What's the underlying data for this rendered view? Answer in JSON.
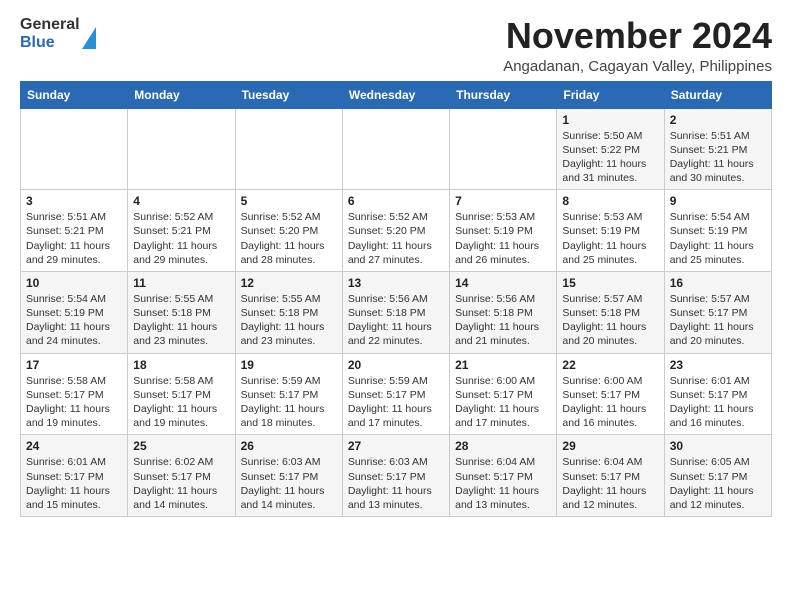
{
  "header": {
    "logo_general": "General",
    "logo_blue": "Blue",
    "month": "November 2024",
    "location": "Angadanan, Cagayan Valley, Philippines"
  },
  "days_of_week": [
    "Sunday",
    "Monday",
    "Tuesday",
    "Wednesday",
    "Thursday",
    "Friday",
    "Saturday"
  ],
  "weeks": [
    [
      {
        "day": "",
        "info": ""
      },
      {
        "day": "",
        "info": ""
      },
      {
        "day": "",
        "info": ""
      },
      {
        "day": "",
        "info": ""
      },
      {
        "day": "",
        "info": ""
      },
      {
        "day": "1",
        "info": "Sunrise: 5:50 AM\nSunset: 5:22 PM\nDaylight: 11 hours and 31 minutes."
      },
      {
        "day": "2",
        "info": "Sunrise: 5:51 AM\nSunset: 5:21 PM\nDaylight: 11 hours and 30 minutes."
      }
    ],
    [
      {
        "day": "3",
        "info": "Sunrise: 5:51 AM\nSunset: 5:21 PM\nDaylight: 11 hours and 29 minutes."
      },
      {
        "day": "4",
        "info": "Sunrise: 5:52 AM\nSunset: 5:21 PM\nDaylight: 11 hours and 29 minutes."
      },
      {
        "day": "5",
        "info": "Sunrise: 5:52 AM\nSunset: 5:20 PM\nDaylight: 11 hours and 28 minutes."
      },
      {
        "day": "6",
        "info": "Sunrise: 5:52 AM\nSunset: 5:20 PM\nDaylight: 11 hours and 27 minutes."
      },
      {
        "day": "7",
        "info": "Sunrise: 5:53 AM\nSunset: 5:19 PM\nDaylight: 11 hours and 26 minutes."
      },
      {
        "day": "8",
        "info": "Sunrise: 5:53 AM\nSunset: 5:19 PM\nDaylight: 11 hours and 25 minutes."
      },
      {
        "day": "9",
        "info": "Sunrise: 5:54 AM\nSunset: 5:19 PM\nDaylight: 11 hours and 25 minutes."
      }
    ],
    [
      {
        "day": "10",
        "info": "Sunrise: 5:54 AM\nSunset: 5:19 PM\nDaylight: 11 hours and 24 minutes."
      },
      {
        "day": "11",
        "info": "Sunrise: 5:55 AM\nSunset: 5:18 PM\nDaylight: 11 hours and 23 minutes."
      },
      {
        "day": "12",
        "info": "Sunrise: 5:55 AM\nSunset: 5:18 PM\nDaylight: 11 hours and 23 minutes."
      },
      {
        "day": "13",
        "info": "Sunrise: 5:56 AM\nSunset: 5:18 PM\nDaylight: 11 hours and 22 minutes."
      },
      {
        "day": "14",
        "info": "Sunrise: 5:56 AM\nSunset: 5:18 PM\nDaylight: 11 hours and 21 minutes."
      },
      {
        "day": "15",
        "info": "Sunrise: 5:57 AM\nSunset: 5:18 PM\nDaylight: 11 hours and 20 minutes."
      },
      {
        "day": "16",
        "info": "Sunrise: 5:57 AM\nSunset: 5:17 PM\nDaylight: 11 hours and 20 minutes."
      }
    ],
    [
      {
        "day": "17",
        "info": "Sunrise: 5:58 AM\nSunset: 5:17 PM\nDaylight: 11 hours and 19 minutes."
      },
      {
        "day": "18",
        "info": "Sunrise: 5:58 AM\nSunset: 5:17 PM\nDaylight: 11 hours and 19 minutes."
      },
      {
        "day": "19",
        "info": "Sunrise: 5:59 AM\nSunset: 5:17 PM\nDaylight: 11 hours and 18 minutes."
      },
      {
        "day": "20",
        "info": "Sunrise: 5:59 AM\nSunset: 5:17 PM\nDaylight: 11 hours and 17 minutes."
      },
      {
        "day": "21",
        "info": "Sunrise: 6:00 AM\nSunset: 5:17 PM\nDaylight: 11 hours and 17 minutes."
      },
      {
        "day": "22",
        "info": "Sunrise: 6:00 AM\nSunset: 5:17 PM\nDaylight: 11 hours and 16 minutes."
      },
      {
        "day": "23",
        "info": "Sunrise: 6:01 AM\nSunset: 5:17 PM\nDaylight: 11 hours and 16 minutes."
      }
    ],
    [
      {
        "day": "24",
        "info": "Sunrise: 6:01 AM\nSunset: 5:17 PM\nDaylight: 11 hours and 15 minutes."
      },
      {
        "day": "25",
        "info": "Sunrise: 6:02 AM\nSunset: 5:17 PM\nDaylight: 11 hours and 14 minutes."
      },
      {
        "day": "26",
        "info": "Sunrise: 6:03 AM\nSunset: 5:17 PM\nDaylight: 11 hours and 14 minutes."
      },
      {
        "day": "27",
        "info": "Sunrise: 6:03 AM\nSunset: 5:17 PM\nDaylight: 11 hours and 13 minutes."
      },
      {
        "day": "28",
        "info": "Sunrise: 6:04 AM\nSunset: 5:17 PM\nDaylight: 11 hours and 13 minutes."
      },
      {
        "day": "29",
        "info": "Sunrise: 6:04 AM\nSunset: 5:17 PM\nDaylight: 11 hours and 12 minutes."
      },
      {
        "day": "30",
        "info": "Sunrise: 6:05 AM\nSunset: 5:17 PM\nDaylight: 11 hours and 12 minutes."
      }
    ]
  ]
}
